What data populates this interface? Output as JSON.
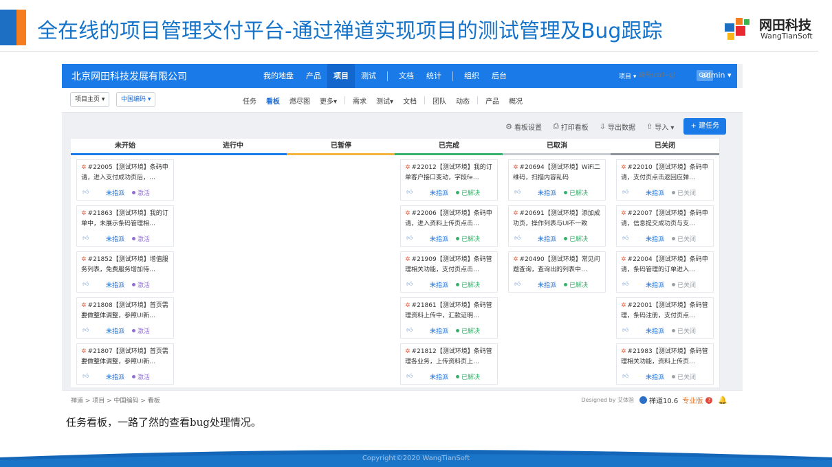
{
  "slide": {
    "title": "全在线的项目管理交付平台-通过禅道实现项目的测试管理及Bug跟踪",
    "brand_cn": "网田科技",
    "brand_en": "WangTianSoft",
    "caption": "任务看板，一路了然的查看bug处理情况。",
    "copyright": "Copyright©2020 WangTianSoft",
    "colors": {
      "title": "#1573c9",
      "accent_blue": "#1d6fc4",
      "accent_orange": "#f47d20"
    }
  },
  "app": {
    "company": "北京网田科技发展有限公司",
    "nav": [
      "我的地盘",
      "产品",
      "项目",
      "测试",
      "文档",
      "统计",
      "组织",
      "后台"
    ],
    "nav_active": "项目",
    "search_type": "项目 ▾",
    "search_placeholder": "编号(ctrl+g)",
    "search_go": "GO!",
    "user": "admin ▾",
    "crumb_home": "项目主页 ▾",
    "crumb_product": "中国编码 ▾",
    "subnav": [
      "任务",
      "看板",
      "燃尽图",
      "更多▾",
      "需求",
      "测试▾",
      "文档",
      "团队",
      "动态",
      "产品",
      "概况"
    ],
    "subnav_active": "看板",
    "toolbar": {
      "board_settings": "看板设置",
      "print_board": "打印看板",
      "export": "导出数据",
      "import": "导入 ▾",
      "create_task": "+ 建任务"
    },
    "colors": {
      "primary": "#1a7be8",
      "topbar_active": "#1366cc"
    }
  },
  "board": {
    "columns": [
      {
        "name": "未开始",
        "accent": "#1a7be8",
        "cards": [
          {
            "title": "#22005【测试环境】条码申请，进入支付成功页后，…",
            "assign": "未指派",
            "status": "激活",
            "status_color": "#8e6fd0"
          },
          {
            "title": "#21863【测试环境】我的订单中，未展示条码管理相…",
            "assign": "未指派",
            "status": "激活",
            "status_color": "#8e6fd0"
          },
          {
            "title": "#21852【测试环境】增值服务列表，免费服务增加待…",
            "assign": "未指派",
            "status": "激活",
            "status_color": "#8e6fd0"
          },
          {
            "title": "#21808【测试环境】首页需要做整体调整，参照UI新…",
            "assign": "未指派",
            "status": "激活",
            "status_color": "#8e6fd0"
          },
          {
            "title": "#21807【测试环境】首页需要做整体调整，参照UI新…",
            "assign": "未指派",
            "status": "激活",
            "status_color": "#8e6fd0"
          }
        ]
      },
      {
        "name": "进行中",
        "accent": "#1a7be8",
        "cards": []
      },
      {
        "name": "已暂停",
        "accent": "#f3b33d",
        "cards": []
      },
      {
        "name": "已完成",
        "accent": "#37b26c",
        "cards": [
          {
            "title": "#22012【测试环境】我的订单客户接口变动，字段fe…",
            "assign": "未指派",
            "status": "已解决",
            "status_color": "#37b26c"
          },
          {
            "title": "#22006【测试环境】条码申请，进入资料上传页点击…",
            "assign": "未指派",
            "status": "已解决",
            "status_color": "#37b26c"
          },
          {
            "title": "#21909【测试环境】条码管理相关功能，支付页点击…",
            "assign": "未指派",
            "status": "已解决",
            "status_color": "#37b26c"
          },
          {
            "title": "#21861【测试环境】条码管理资料上传中，汇款证明…",
            "assign": "未指派",
            "status": "已解决",
            "status_color": "#37b26c"
          },
          {
            "title": "#21812【测试环境】条码管理各业务，上传资料页上…",
            "assign": "未指派",
            "status": "已解决",
            "status_color": "#37b26c"
          }
        ]
      },
      {
        "name": "已取消",
        "accent": "#c7ccd2",
        "cards": [
          {
            "title": "#20694【测试环境】WiFi二维码，扫描内容乱码",
            "assign": "未指派",
            "status": "已解决",
            "status_color": "#37b26c"
          },
          {
            "title": "#20691【测试环境】添加成功页，操作列表与UI不一致",
            "assign": "未指派",
            "status": "已解决",
            "status_color": "#37b26c"
          },
          {
            "title": "#20490【测试环境】常见问题查询，查询出的列表中…",
            "assign": "未指派",
            "status": "已解决",
            "status_color": "#37b26c"
          }
        ]
      },
      {
        "name": "已关闭",
        "accent": "#8d949c",
        "cards": [
          {
            "title": "#22010【测试环境】条码申请，支付页点击返回应弹…",
            "assign": "未指派",
            "status": "已关闭",
            "status_color": "#9aa0a6"
          },
          {
            "title": "#22007【测试环境】条码申请，信息提交成功页与支…",
            "assign": "未指派",
            "status": "已关闭",
            "status_color": "#9aa0a6"
          },
          {
            "title": "#22004【测试环境】条码申请，条码管理的订单进入…",
            "assign": "未指派",
            "status": "已关闭",
            "status_color": "#9aa0a6"
          },
          {
            "title": "#22001【测试环境】条码管理，条码注册，支付页点…",
            "assign": "未指派",
            "status": "已关闭",
            "status_color": "#9aa0a6"
          },
          {
            "title": "#21983【测试环境】条码管理相关功能，资料上传页…",
            "assign": "未指派",
            "status": "已关闭",
            "status_color": "#9aa0a6"
          }
        ]
      }
    ]
  },
  "footer": {
    "breadcrumb": "禅道 > 项目 > 中国编码 > 看板",
    "designed_by": "Designed by 艾体验",
    "version": "禅道10.6",
    "edition": "专业版"
  }
}
